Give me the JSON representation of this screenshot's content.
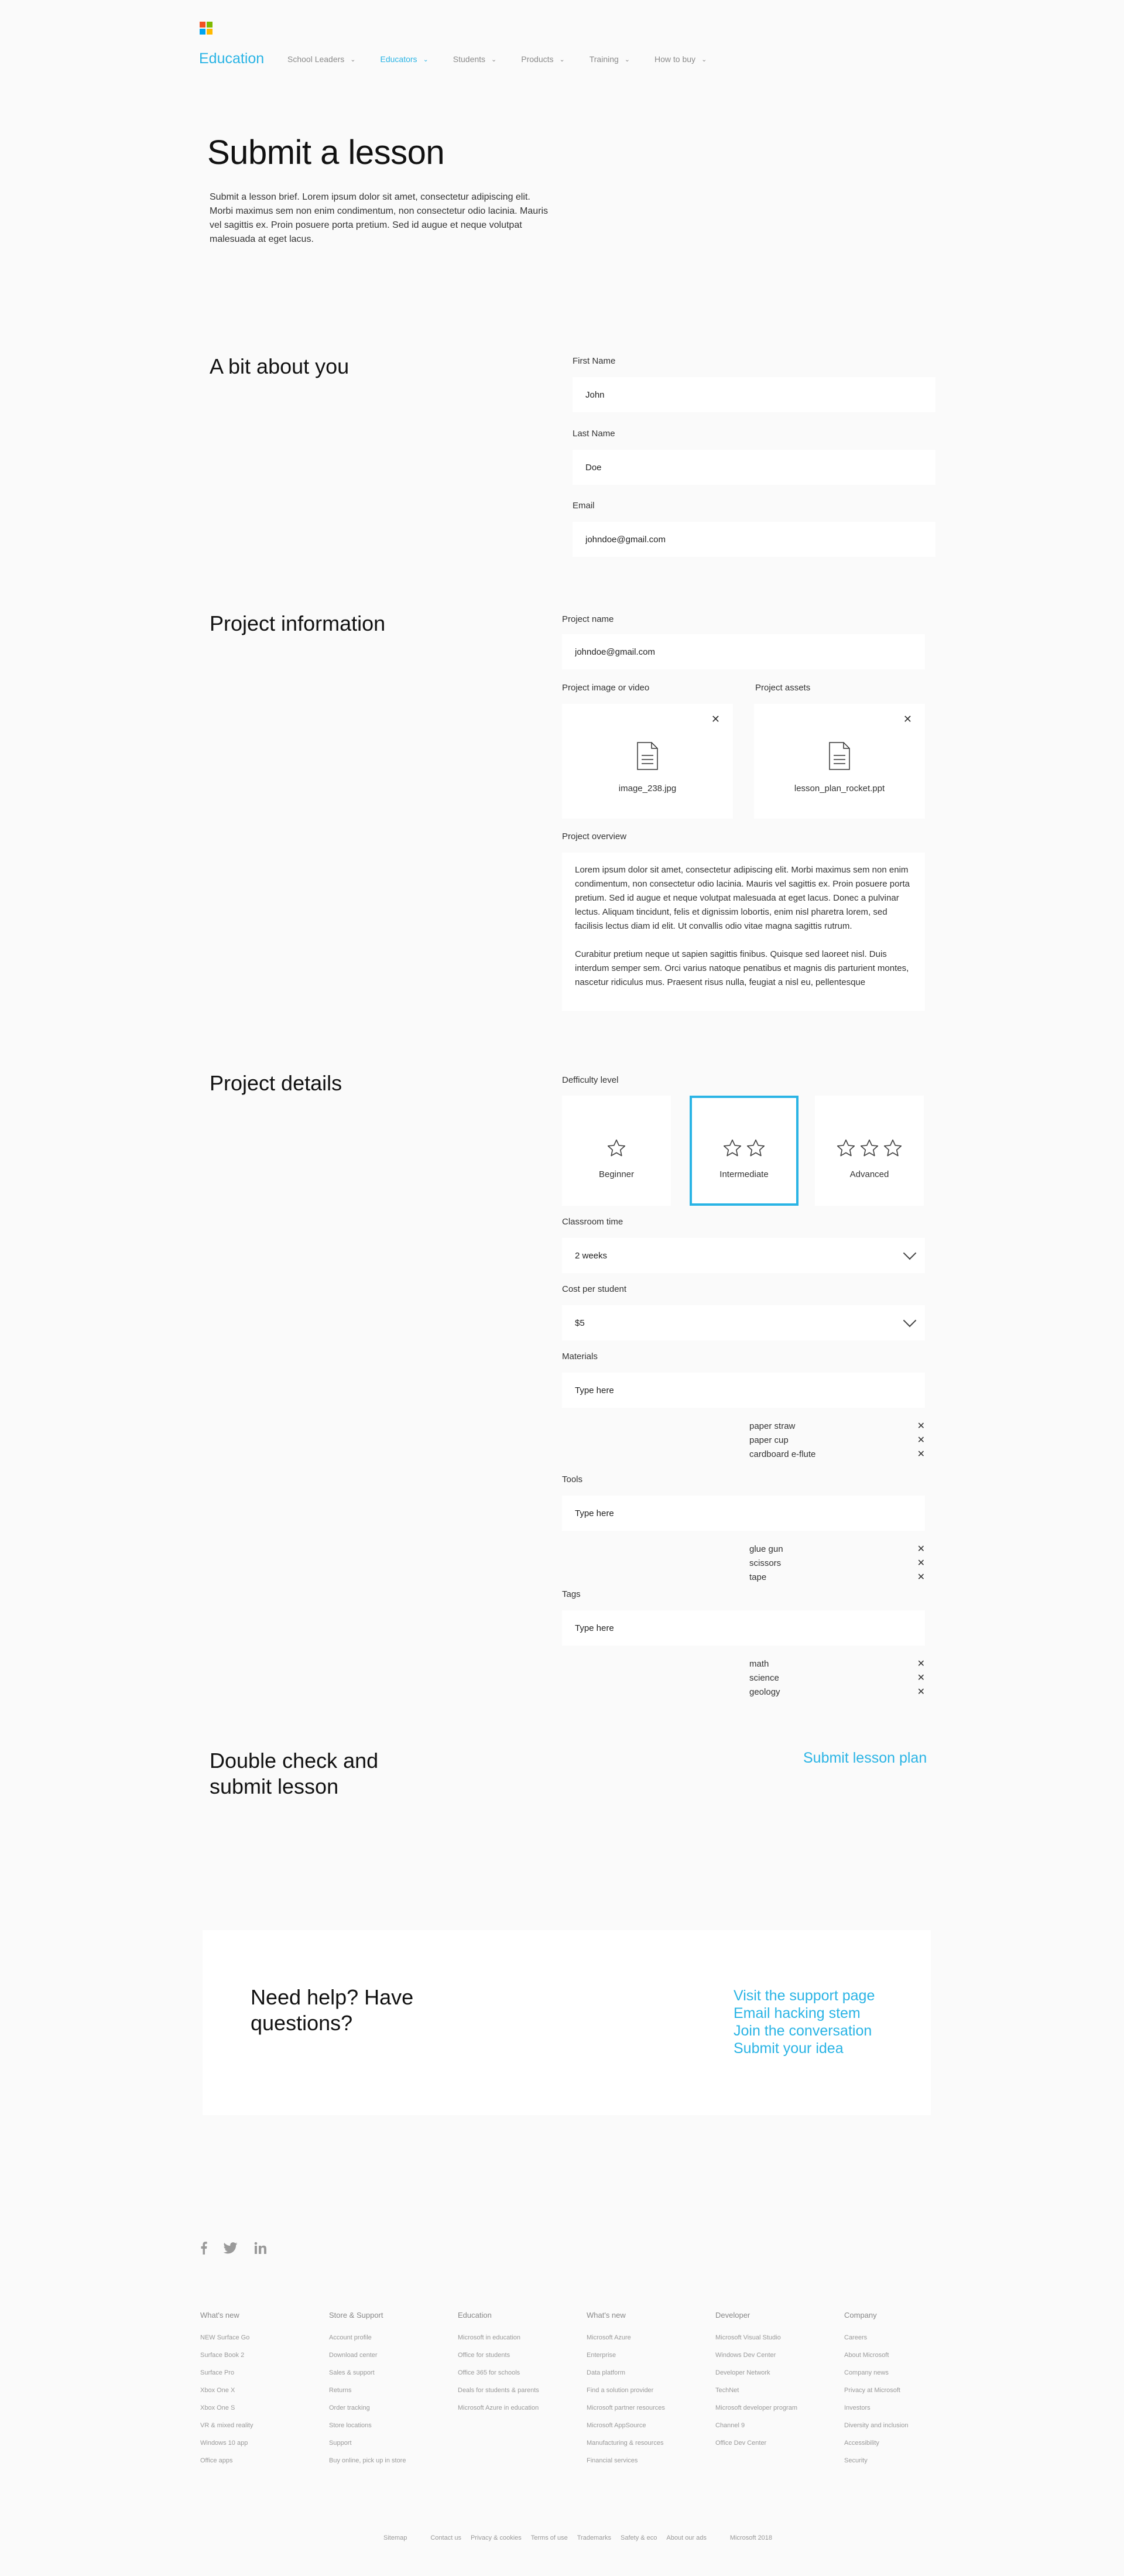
{
  "header": {
    "brand": "Education",
    "nav": [
      {
        "label": "School Leaders",
        "active": false
      },
      {
        "label": "Educators",
        "active": true
      },
      {
        "label": "Students",
        "active": false
      },
      {
        "label": "Products",
        "active": false
      },
      {
        "label": "Training",
        "active": false
      },
      {
        "label": "How to buy",
        "active": false
      }
    ],
    "logo_colors": [
      "#f25022",
      "#7fba00",
      "#00a4ef",
      "#ffb900"
    ]
  },
  "hero": {
    "title": "Submit a lesson",
    "text": "Submit a lesson brief. Lorem ipsum dolor sit amet, consectetur adipiscing elit. Morbi maximus sem non enim condimentum, non consectetur odio lacinia. Mauris vel sagittis ex. Proin posuere porta pretium. Sed id augue et neque volutpat malesuada at eget lacus."
  },
  "about": {
    "title": "A bit about you",
    "first_name_label": "First Name",
    "first_name": "John",
    "last_name_label": "Last Name",
    "last_name": "Doe",
    "email_label": "Email",
    "email": "johndoe@gmail.com"
  },
  "project_info": {
    "title": "Project information",
    "name_label": "Project name",
    "name_value": "johndoe@gmail.com",
    "image_label": "Project image or video",
    "image_file": "image_238.jpg",
    "assets_label": "Project assets",
    "assets_file": "lesson_plan_rocket.ppt",
    "overview_label": "Project overview",
    "overview_p1": "Lorem ipsum dolor sit amet, consectetur adipiscing elit. Morbi maximus sem non enim condimentum, non consectetur odio lacinia. Mauris vel sagittis ex. Proin posuere porta pretium. Sed id augue et neque volutpat malesuada at eget lacus. Donec a pulvinar lectus. Aliquam tincidunt, felis et dignissim lobortis, enim nisl pharetra lorem, sed facilisis lectus diam id elit. Ut convallis odio vitae magna sagittis rutrum.",
    "overview_p2": "Curabitur pretium neque ut sapien sagittis finibus. Quisque sed laoreet nisl. Duis interdum semper sem. Orci varius natoque penatibus et magnis dis parturient montes, nascetur ridiculus mus. Praesent risus nulla, feugiat a nisl eu, pellentesque"
  },
  "details": {
    "title": "Project details",
    "difficulty_label": "Defficulty level",
    "levels": [
      {
        "label": "Beginner",
        "stars": 1,
        "selected": false
      },
      {
        "label": "Intermediate",
        "stars": 2,
        "selected": true
      },
      {
        "label": "Advanced",
        "stars": 3,
        "selected": false
      }
    ],
    "classroom_label": "Classroom time",
    "classroom_value": "2 weeks",
    "cost_label": "Cost per student",
    "cost_value": "$5",
    "materials_label": "Materials",
    "materials_placeholder": "Type here",
    "materials": [
      "paper straw",
      "paper cup",
      "cardboard e-flute"
    ],
    "tools_label": "Tools",
    "tools_placeholder": "Type here",
    "tools": [
      "glue gun",
      "scissors",
      "tape"
    ],
    "tags_label": "Tags",
    "tags_placeholder": "Type here",
    "tags": [
      "math",
      "science",
      "geology"
    ]
  },
  "submit": {
    "title_line1": "Double check and",
    "title_line2": "submit lesson",
    "link": "Submit lesson plan"
  },
  "help": {
    "title_line1": "Need help? Have",
    "title_line2": "questions?",
    "links": [
      "Visit the support page",
      "Email hacking stem",
      "Join the conversation",
      "Submit your idea"
    ]
  },
  "footer": {
    "social": [
      "facebook-icon",
      "twitter-icon",
      "linkedin-icon"
    ],
    "columns": [
      {
        "heading": "What's new",
        "links": [
          "NEW Surface Go",
          "Surface Book 2",
          "Surface Pro",
          "Xbox One X",
          "Xbox One S",
          "VR & mixed reality",
          "Windows 10 app",
          "Office apps"
        ]
      },
      {
        "heading": "Store & Support",
        "links": [
          "Account profile",
          "Download center",
          "Sales & support",
          "Returns",
          "Order tracking",
          "Store locations",
          "Support",
          "Buy online, pick up in store"
        ]
      },
      {
        "heading": "Education",
        "links": [
          "Microsoft in education",
          "Office for students",
          "Office 365 for schools",
          "Deals for students & parents",
          "Microsoft Azure in education"
        ]
      },
      {
        "heading": "What's new",
        "links": [
          "Microsoft Azure",
          "Enterprise",
          "Data platform",
          "Find a solution provider",
          "Microsoft partner resources",
          "Microsoft AppSource",
          "Manufacturing & resources",
          "Financial services"
        ]
      },
      {
        "heading": "Developer",
        "links": [
          "Microsoft Visual Studio",
          "Windows Dev Center",
          "Developer Network",
          "TechNet",
          "Microsoft developer program",
          "Channel 9",
          "Office Dev Center"
        ]
      },
      {
        "heading": "Company",
        "links": [
          "Careers",
          "About Microsoft",
          "Company news",
          "Privacy at Microsoft",
          "Investors",
          "Diversity and inclusion",
          "Accessibility",
          "Security"
        ]
      }
    ],
    "bottom": [
      "Sitemap",
      "Contact us",
      "Privacy & cookies",
      "Terms of use",
      "Trademarks",
      "Safety & eco",
      "About our ads",
      "Microsoft 2018"
    ]
  },
  "colors": {
    "accent": "#2ab4e5",
    "background": "#fafafa"
  }
}
